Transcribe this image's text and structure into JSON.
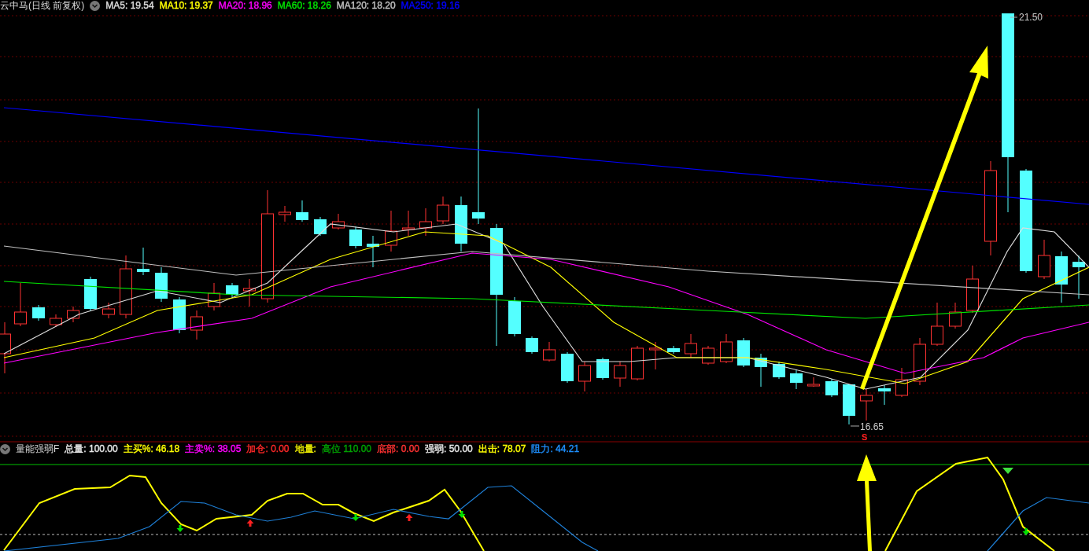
{
  "main_panel": {
    "title": "云中马(日线 前复权)",
    "ma_legend": [
      {
        "label": "MA5: 19.54",
        "color": "#dcdcdc"
      },
      {
        "label": "MA10: 19.37",
        "color": "#ffff00"
      },
      {
        "label": "MA20: 18.96",
        "color": "#ff00ff"
      },
      {
        "label": "MA60: 18.26",
        "color": "#00e600"
      },
      {
        "label": "MA120: 18.20",
        "color": "#c0c0c0"
      },
      {
        "label": "MA250: 19.16",
        "color": "#0000ff"
      }
    ],
    "high_label": "21.50",
    "low_label": "16.65",
    "signal_mark": "S"
  },
  "indicator_panel": {
    "title": "量能强弱F",
    "legend": [
      {
        "text": "总量: 100.00",
        "color": "#e6e6e6"
      },
      {
        "text": "主买%: 46.18",
        "color": "#ffff00"
      },
      {
        "text": "主卖%: 38.05",
        "color": "#ff00ff"
      },
      {
        "text": "加仓: 0.00",
        "color": "#ff2828"
      },
      {
        "text": "地量:",
        "color": "#f0f000"
      },
      {
        "text": "高位 110.00",
        "color": "#00a000"
      },
      {
        "text": "底部: 0.00",
        "color": "#ff3232"
      },
      {
        "text": "强弱: 50.00",
        "color": "#e6e6e6"
      },
      {
        "text": "出击: 78.07",
        "color": "#ffff00"
      },
      {
        "text": "阻力: 44.21",
        "color": "#1e90ff"
      }
    ]
  }
}
